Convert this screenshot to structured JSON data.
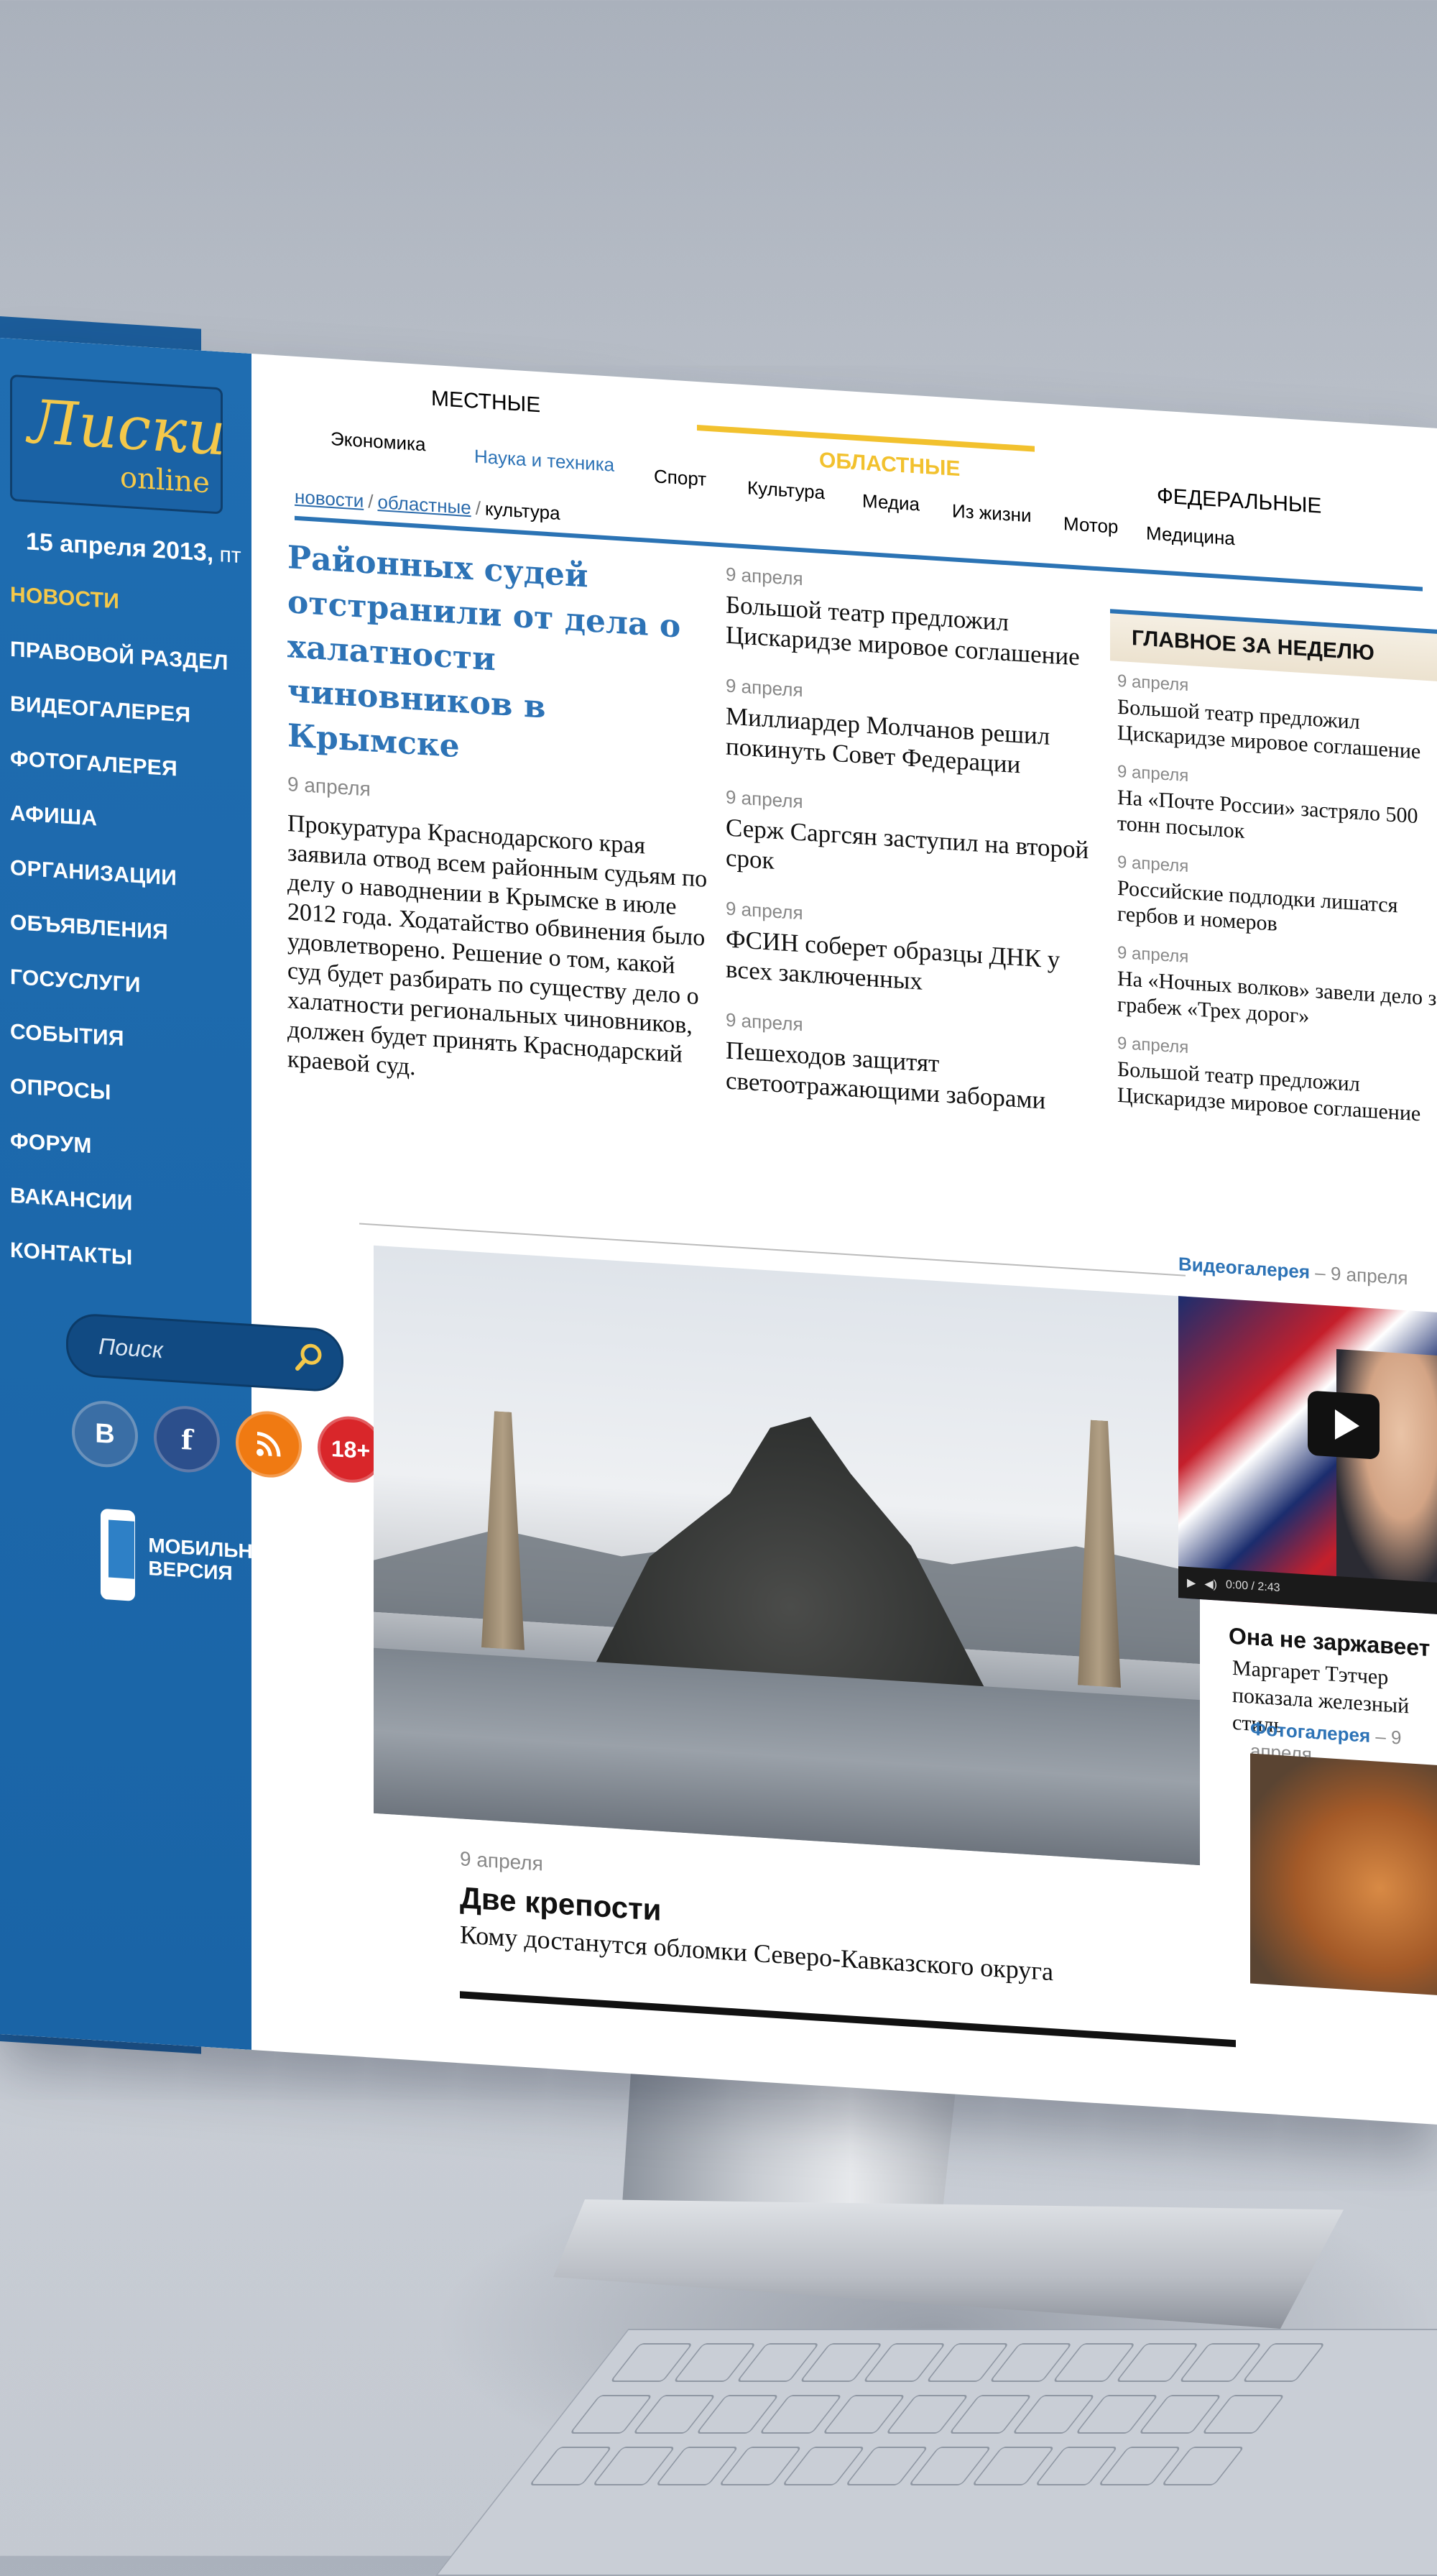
{
  "sidebar": {
    "logo_main": "Лиски",
    "logo_sub": "online",
    "date_day": "15 апреля",
    "date_year": "2013,",
    "date_weekday": "пт",
    "nav": [
      "НОВОСТИ",
      "ПРАВОВОЙ РАЗДЕЛ",
      "ВИДЕОГАЛЕРЕЯ",
      "ФОТОГАЛЕРЕЯ",
      "АФИША",
      "ОРГАНИЗАЦИИ",
      "ОБЪЯВЛЕНИЯ",
      "ГОСУСЛУГИ",
      "СОБЫТИЯ",
      "ОПРОСЫ",
      "ФОРУМ",
      "ВАКАНСИИ",
      "КОНТАКТЫ"
    ],
    "search_placeholder": "Поиск",
    "socials": {
      "vk": "В",
      "fb": "f",
      "age": "18+"
    },
    "mobile_label": "МОБИЛЬНАЯ ВЕРСИЯ"
  },
  "topnav": {
    "tabs": [
      "МЕСТНЫЕ",
      "ОБЛАСТНЫЕ",
      "ФЕДЕРАЛЬНЫЕ"
    ],
    "subs": [
      "Экономика",
      "Наука и техника",
      "Спорт",
      "Культура",
      "Медиа",
      "Из жизни",
      "Мотор",
      "Медицина"
    ],
    "breadcrumbs": [
      "новости",
      "областные",
      "культура"
    ]
  },
  "lead": {
    "title": "Районных судей отстранили от дела о халатности чиновников в Крымске",
    "date": "9 апреля",
    "text": "Прокуратура Краснодарского края заявила отвод всем районным судьям по делу о наводнении в Крымске в июле 2012 года. Ходатайство обвинения было удовлетворено. Решение о том, какой суд будет разбирать по существу дело о халатности региональных чиновников, должен будет принять Краснодарский краевой суд."
  },
  "news": [
    {
      "date": "9 апреля",
      "title": "Большой театр предложил Цискаридзе мировое соглашение"
    },
    {
      "date": "9 апреля",
      "title": "Миллиардер Молчанов решил покинуть Совет Федерации"
    },
    {
      "date": "9 апреля",
      "title": "Серж Саргсян заступил на второй срок"
    },
    {
      "date": "9 апреля",
      "title": "ФСИН соберет образцы ДНК у всех заключенных"
    },
    {
      "date": "9 апреля",
      "title": "Пешеходов защитят светоотражающими заборами"
    }
  ],
  "week": {
    "heading": "ГЛАВНОЕ ЗА НЕДЕЛЮ",
    "items": [
      {
        "date": "9 апреля",
        "title": "Большой театр предложил Цискаридзе мировое соглашение"
      },
      {
        "date": "9 апреля",
        "title": "На «Почте России» застряло 500 тонн посылок"
      },
      {
        "date": "9 апреля",
        "title": "Российские подлодки лишатся гербов и номеров"
      },
      {
        "date": "9 апреля",
        "title": "На «Ночных волков» завели дело за грабеж «Трех дорог»"
      },
      {
        "date": "9 апреля",
        "title": "Большой театр предложил Цискаридзе мировое соглашение"
      }
    ]
  },
  "feature": {
    "date": "9 апреля",
    "title": "Две крепости",
    "subtitle": "Кому достанутся обломки Северо-Кавказского округа"
  },
  "media": {
    "video_label": "Видеогалерея",
    "video_date": "– 9 апреля",
    "video_time": "0:00 / 2:43",
    "video_title": "Она не заржавеет",
    "video_text": "Маргарет Тэтчер показала железный стиль",
    "photo_label": "Фотогалерея",
    "photo_date": "– 9 апреля"
  },
  "colors": {
    "brand_blue": "#1f6db1",
    "accent_yellow": "#f2c12e",
    "link_blue": "#2d73b6"
  }
}
